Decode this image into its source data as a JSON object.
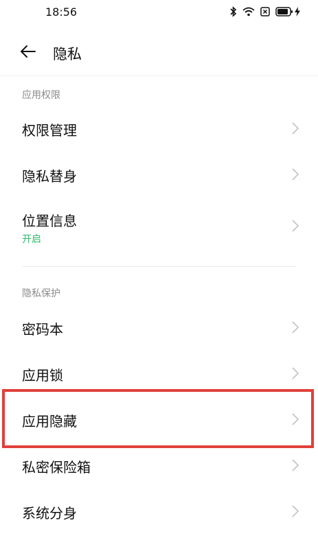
{
  "status": {
    "time": "18:56",
    "icons": [
      "bluetooth-icon",
      "wifi-icon",
      "sim-x-icon",
      "battery-icon",
      "charging-icon"
    ]
  },
  "header": {
    "back_icon": "arrow-left-icon",
    "title": "隐私"
  },
  "sections": [
    {
      "title": "应用权限",
      "items": [
        {
          "label": "权限管理"
        },
        {
          "label": "隐私替身"
        },
        {
          "label": "位置信息",
          "sub": "开启"
        }
      ]
    },
    {
      "title": "隐私保护",
      "items": [
        {
          "label": "密码本"
        },
        {
          "label": "应用锁"
        },
        {
          "label": "应用隐藏"
        },
        {
          "label": "私密保险箱"
        },
        {
          "label": "系统分身"
        }
      ]
    }
  ],
  "colors": {
    "accent_green": "#2fb86b",
    "highlight_red": "#e0403a"
  }
}
